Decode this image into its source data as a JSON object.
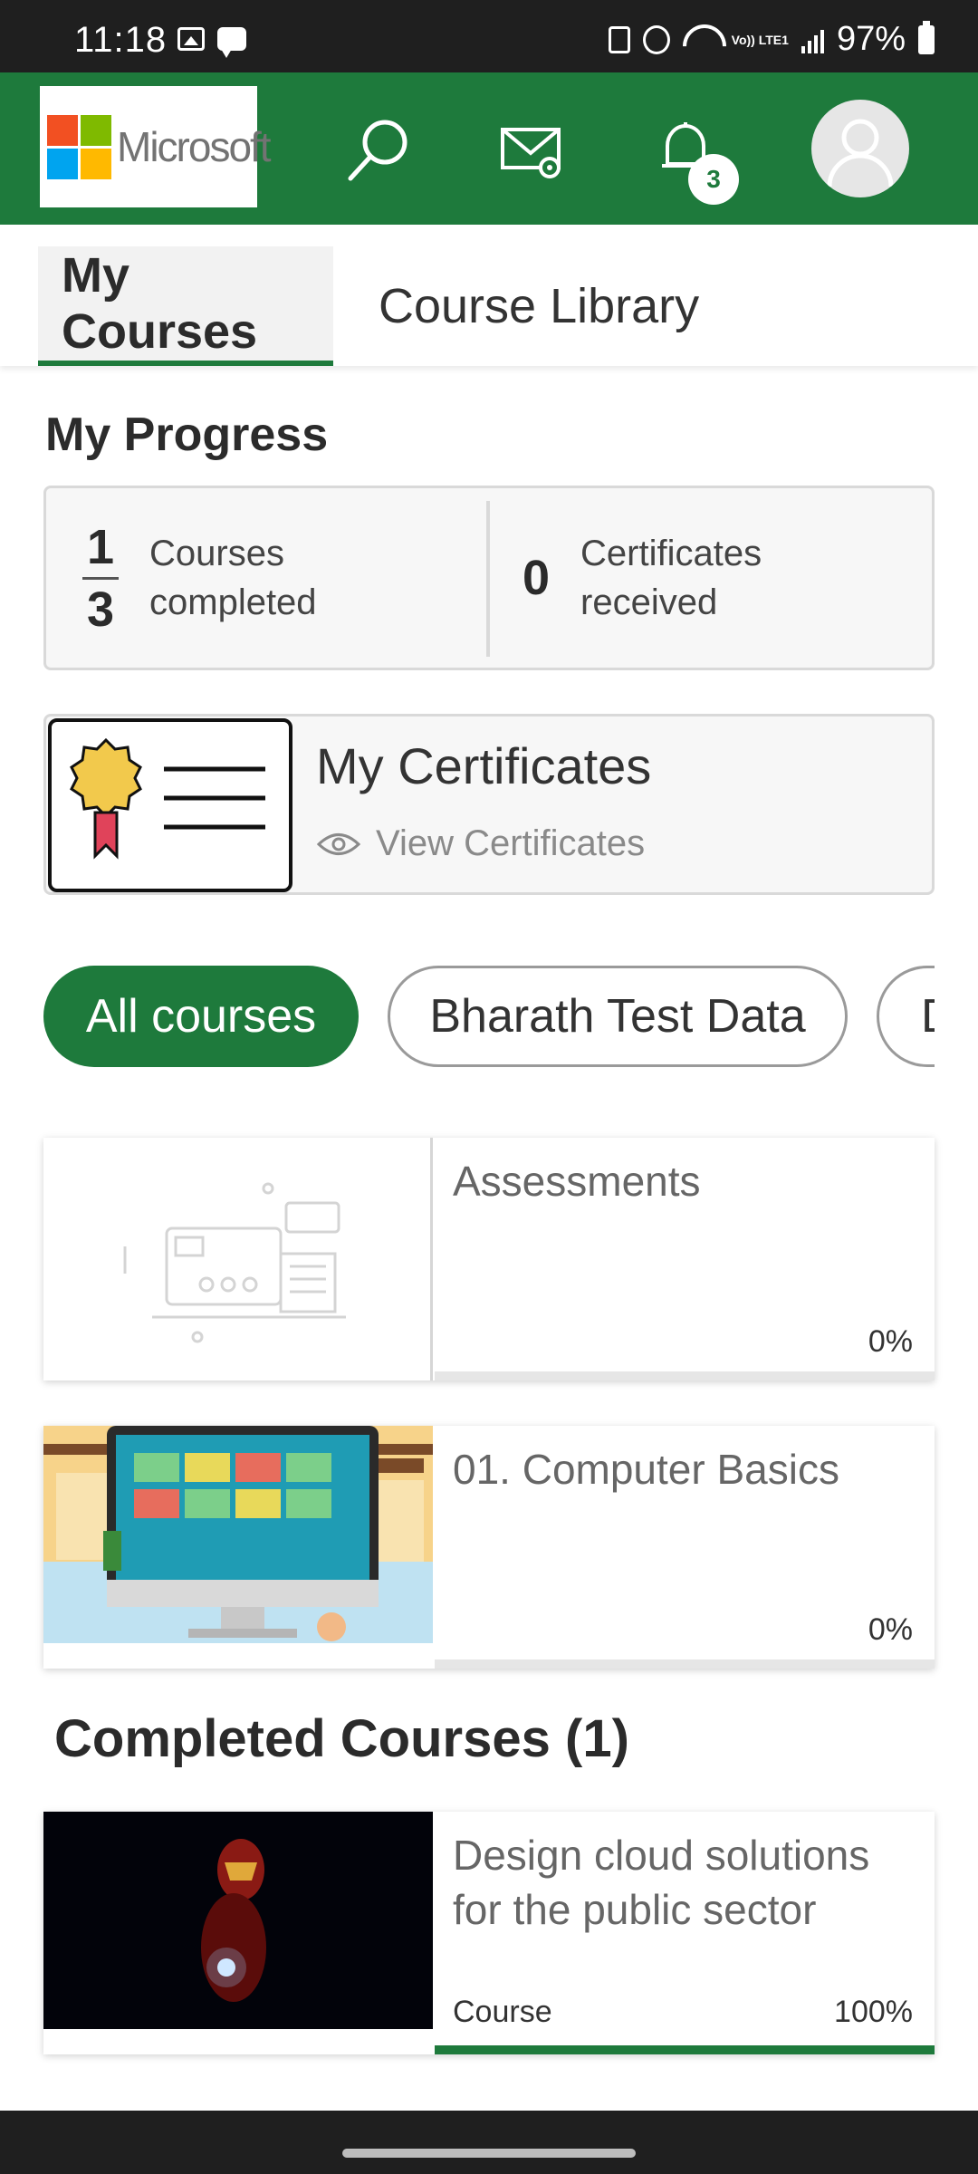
{
  "status_bar": {
    "time": "11:18",
    "battery": "97%",
    "network": "Vo)) LTE1"
  },
  "header": {
    "logo_text": "Microsoft",
    "notification_count": "3",
    "icons": [
      "search-icon",
      "mail-settings-icon",
      "bell-icon",
      "avatar-icon"
    ]
  },
  "tabs": [
    {
      "label": "My Courses",
      "active": true
    },
    {
      "label": "Course Library",
      "active": false
    }
  ],
  "progress": {
    "title": "My Progress",
    "courses_completed": "1",
    "courses_total": "3",
    "courses_label_1": "Courses",
    "courses_label_2": "completed",
    "certificates_count": "0",
    "certificates_label_1": "Certificates",
    "certificates_label_2": "received"
  },
  "certificates": {
    "title": "My Certificates",
    "link": "View Certificates"
  },
  "filters": [
    {
      "label": "All courses",
      "active": true
    },
    {
      "label": "Bharath Test Data",
      "active": false
    },
    {
      "label": "D",
      "active": false
    }
  ],
  "courses": [
    {
      "title": "Assessments",
      "progress_text": "0%",
      "progress": 0
    },
    {
      "title": "01. Computer Basics",
      "progress_text": "0%",
      "progress": 0
    }
  ],
  "completed": {
    "title": "Completed Courses (1)",
    "items": [
      {
        "title": "Design cloud solutions for the public sector",
        "type": "Course",
        "progress_text": "100%",
        "progress": 1.0
      }
    ]
  },
  "colors": {
    "brand_green": "#1e7a3c",
    "status_bar": "#1f1f1f"
  }
}
